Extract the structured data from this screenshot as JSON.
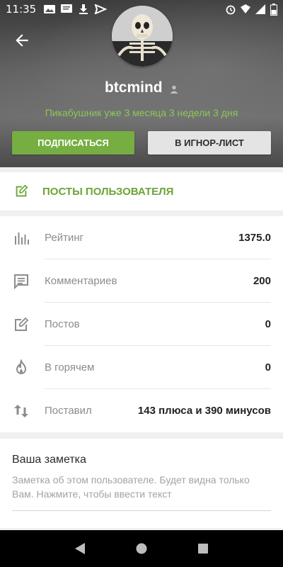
{
  "status_bar": {
    "time": "11:35",
    "left_icons": [
      "image-icon",
      "message-icon",
      "download-icon",
      "send-icon"
    ],
    "right_icons": [
      "alarm-icon",
      "wifi-icon",
      "signal-icon",
      "battery-icon"
    ]
  },
  "profile": {
    "username": "btcmind",
    "since": "Пикабушник уже 3 месяца 3 недели 3 дня",
    "subscribe_label": "ПОДПИСАТЬСЯ",
    "ignore_label": "В ИГНОР-ЛИСТ"
  },
  "posts_link": {
    "label": "ПОСТЫ ПОЛЬЗОВАТЕЛЯ"
  },
  "stats": [
    {
      "icon": "bar-chart-icon",
      "label": "Рейтинг",
      "value": "1375.0"
    },
    {
      "icon": "comment-icon",
      "label": "Комментариев",
      "value": "200"
    },
    {
      "icon": "edit-icon",
      "label": "Постов",
      "value": "0"
    },
    {
      "icon": "fire-icon",
      "label": "В горячем",
      "value": "0"
    },
    {
      "icon": "swap-vertical-icon",
      "label": "Поставил",
      "value": "143 плюса и 390 минусов"
    }
  ],
  "note": {
    "title": "Ваша заметка",
    "description": "Заметка об этом пользователе. Будет видна только Вам. Нажмите, чтобы ввести текст"
  },
  "colors": {
    "accent_green": "#76ae42",
    "since_green": "#8ac858",
    "link_green": "#6aa437"
  }
}
